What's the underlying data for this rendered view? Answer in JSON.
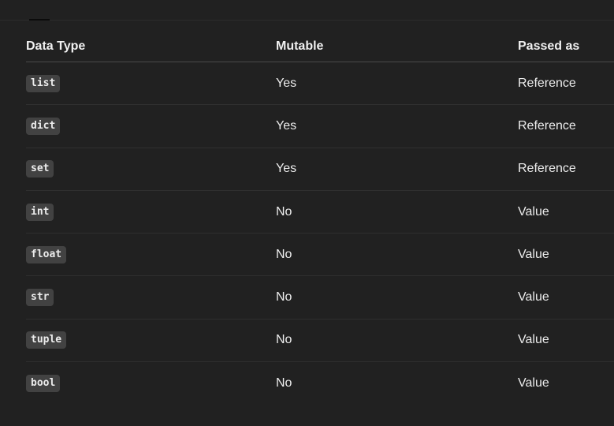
{
  "table": {
    "headers": {
      "type": "Data Type",
      "mutable": "Mutable",
      "passed": "Passed as"
    },
    "rows": [
      {
        "type": "list",
        "mutable": "Yes",
        "passed": "Reference"
      },
      {
        "type": "dict",
        "mutable": "Yes",
        "passed": "Reference"
      },
      {
        "type": "set",
        "mutable": "Yes",
        "passed": "Reference"
      },
      {
        "type": "int",
        "mutable": "No",
        "passed": "Value"
      },
      {
        "type": "float",
        "mutable": "No",
        "passed": "Value"
      },
      {
        "type": "str",
        "mutable": "No",
        "passed": "Value"
      },
      {
        "type": "tuple",
        "mutable": "No",
        "passed": "Value"
      },
      {
        "type": "bool",
        "mutable": "No",
        "passed": "Value"
      }
    ]
  },
  "colors": {
    "background": "#212121",
    "text": "#ececec",
    "code_background": "#424242"
  }
}
